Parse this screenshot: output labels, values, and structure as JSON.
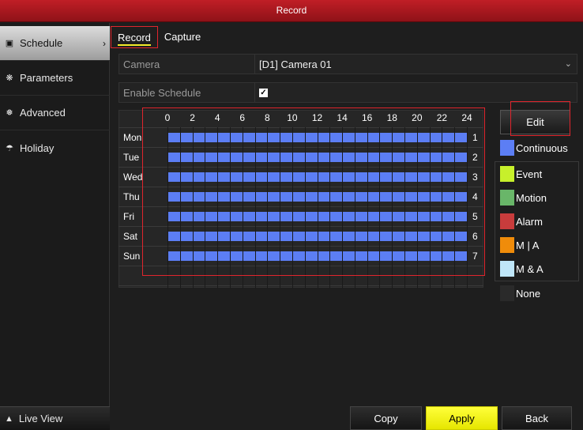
{
  "window": {
    "title": "Record"
  },
  "sidebar": {
    "items": [
      {
        "label": "Schedule",
        "icon": "calendar-icon"
      },
      {
        "label": "Parameters",
        "icon": "gear-icon"
      },
      {
        "label": "Advanced",
        "icon": "gears-icon"
      },
      {
        "label": "Holiday",
        "icon": "umbrella-icon"
      }
    ],
    "footer": {
      "label": "Live View",
      "icon": "home-icon"
    }
  },
  "tabs": [
    {
      "label": "Record"
    },
    {
      "label": "Capture"
    }
  ],
  "form": {
    "camera_label": "Camera",
    "camera_value": "[D1] Camera 01",
    "enable_label": "Enable Schedule",
    "enable_checked": true
  },
  "schedule": {
    "hours": [
      "0",
      "2",
      "4",
      "6",
      "8",
      "10",
      "12",
      "14",
      "16",
      "18",
      "20",
      "22",
      "24"
    ],
    "days": [
      {
        "label": "Mon",
        "num": "1",
        "type": "Continuous"
      },
      {
        "label": "Tue",
        "num": "2",
        "type": "Continuous"
      },
      {
        "label": "Wed",
        "num": "3",
        "type": "Continuous"
      },
      {
        "label": "Thu",
        "num": "4",
        "type": "Continuous"
      },
      {
        "label": "Fri",
        "num": "5",
        "type": "Continuous"
      },
      {
        "label": "Sat",
        "num": "6",
        "type": "Continuous"
      },
      {
        "label": "Sun",
        "num": "7",
        "type": "Continuous"
      }
    ]
  },
  "edit_button": "Edit",
  "legend": [
    {
      "label": "Continuous",
      "color": "#5c7ef4"
    },
    {
      "label": "Event",
      "color": "#c7f02b"
    },
    {
      "label": "Motion",
      "color": "#69b669"
    },
    {
      "label": "Alarm",
      "color": "#c83c3c"
    },
    {
      "label": "M | A",
      "color": "#f08c0a"
    },
    {
      "label": "M & A",
      "color": "#bfe6f8"
    },
    {
      "label": "None",
      "color": "#2a2a2a"
    }
  ],
  "buttons": {
    "copy": "Copy",
    "apply": "Apply",
    "back": "Back"
  },
  "colors": {
    "title_red": "#c01e26",
    "apply_yellow": "#ffff3a",
    "highlight_red": "#e0252d"
  }
}
